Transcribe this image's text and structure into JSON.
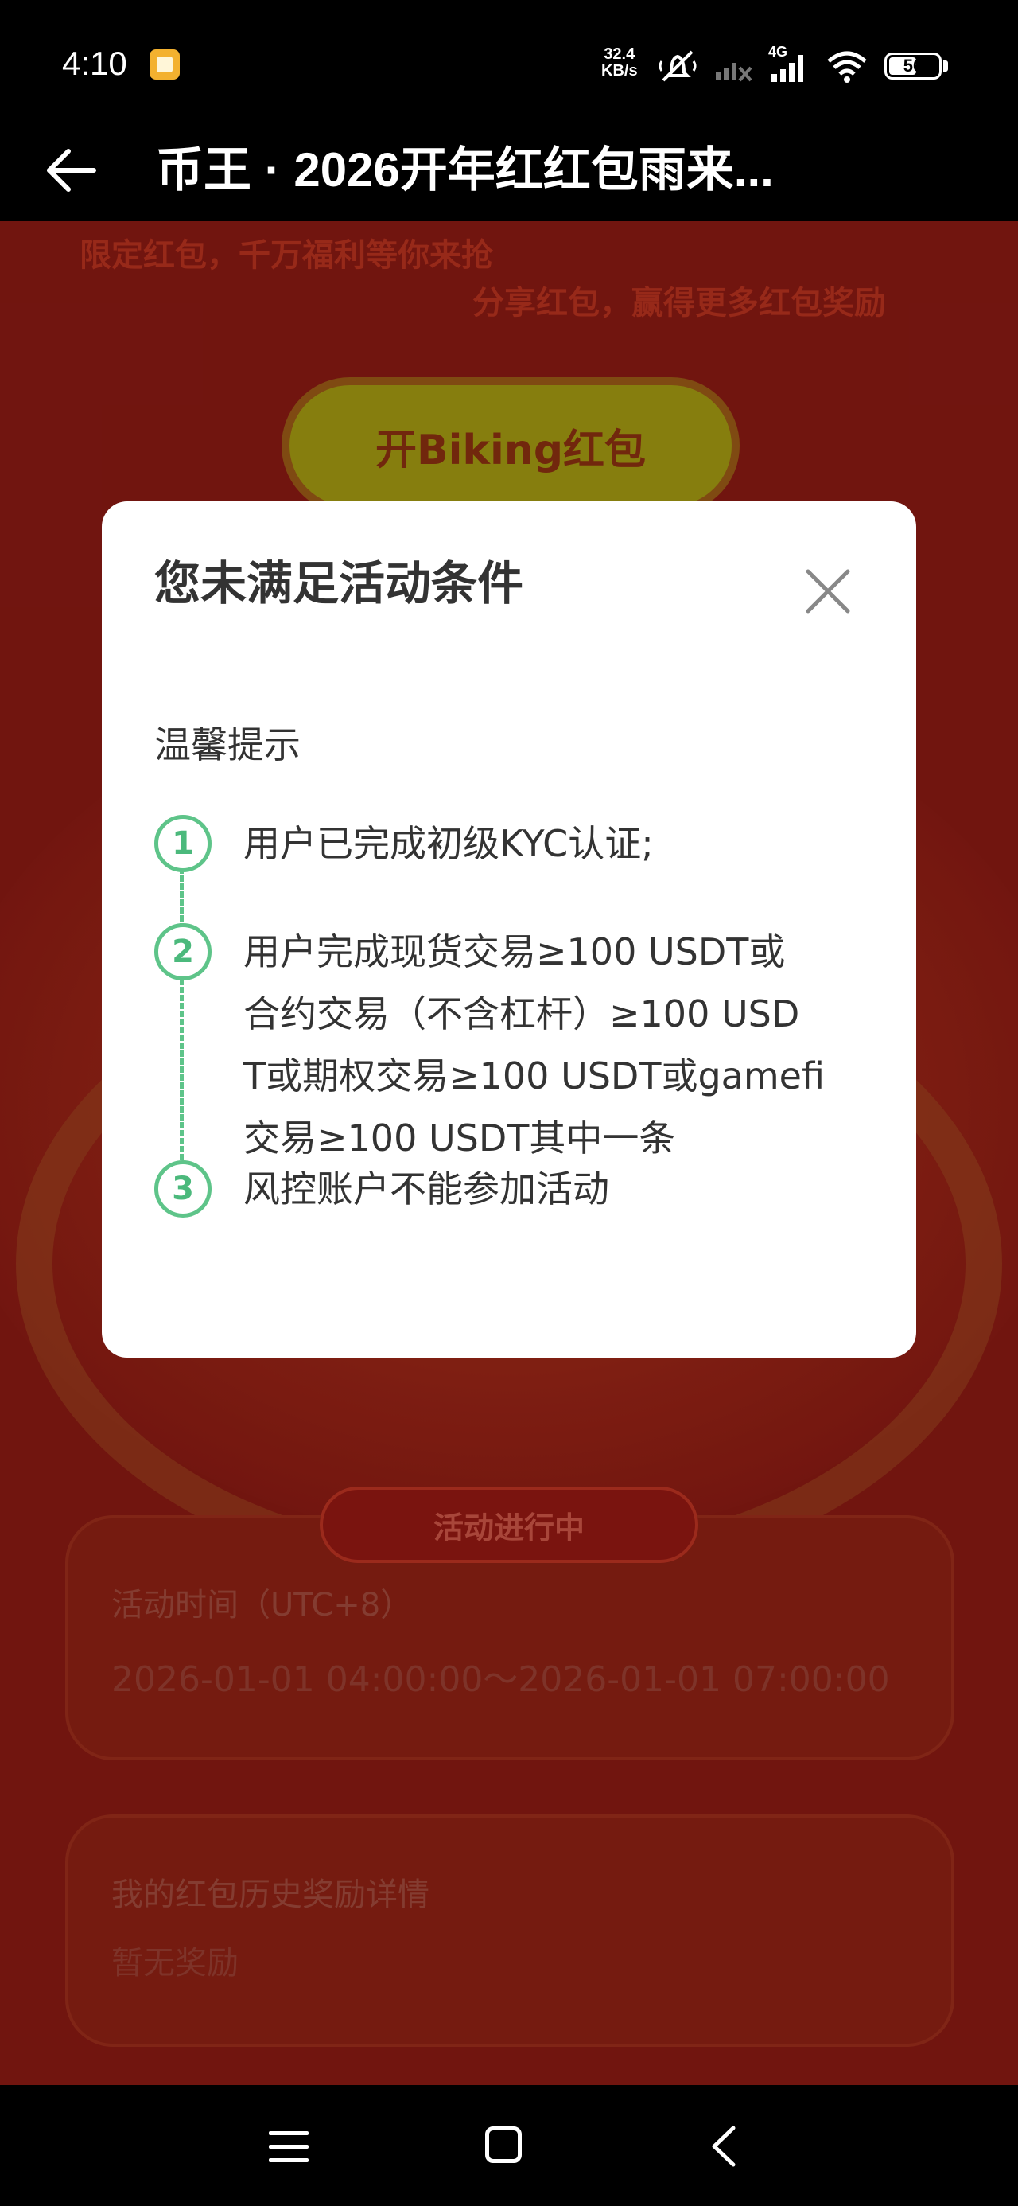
{
  "status_bar": {
    "time": "4:10",
    "net_speed_value": "32.4",
    "net_speed_unit": "KB/s",
    "network": "4G",
    "battery": "56"
  },
  "app_bar": {
    "title": "币王 · 2026开年红红包雨来..."
  },
  "background": {
    "line1": "限定红包，千万福利等你来抢",
    "line2": "分享红包，赢得更多红包奖励",
    "open_button": "开Biking红包",
    "status_pill": "活动进行中",
    "time_card": {
      "title": "活动时间（UTC+8）",
      "value": "2026-01-01 04:00:00～2026-01-01 07:00:00"
    },
    "history_card": {
      "title": "我的红包历史奖励详情",
      "value": "暂无奖励"
    }
  },
  "modal": {
    "title": "您未满足活动条件",
    "tip_label": "温馨提示",
    "steps": [
      {
        "num": "1",
        "lines": [
          "用户已完成初级KYC认证;"
        ]
      },
      {
        "num": "2",
        "lines": [
          "用户完成现货交易≥100 USDT或",
          "合约交易（不含杠杆）≥100 USD",
          "T或期权交易≥100 USDT或gamefi",
          "交易≥100 USDT其中一条"
        ]
      },
      {
        "num": "3",
        "lines": [
          "风控账户不能参加活动"
        ]
      }
    ]
  },
  "colors": {
    "accent_green": "#5ec489",
    "page_red": "#8a1a13"
  }
}
